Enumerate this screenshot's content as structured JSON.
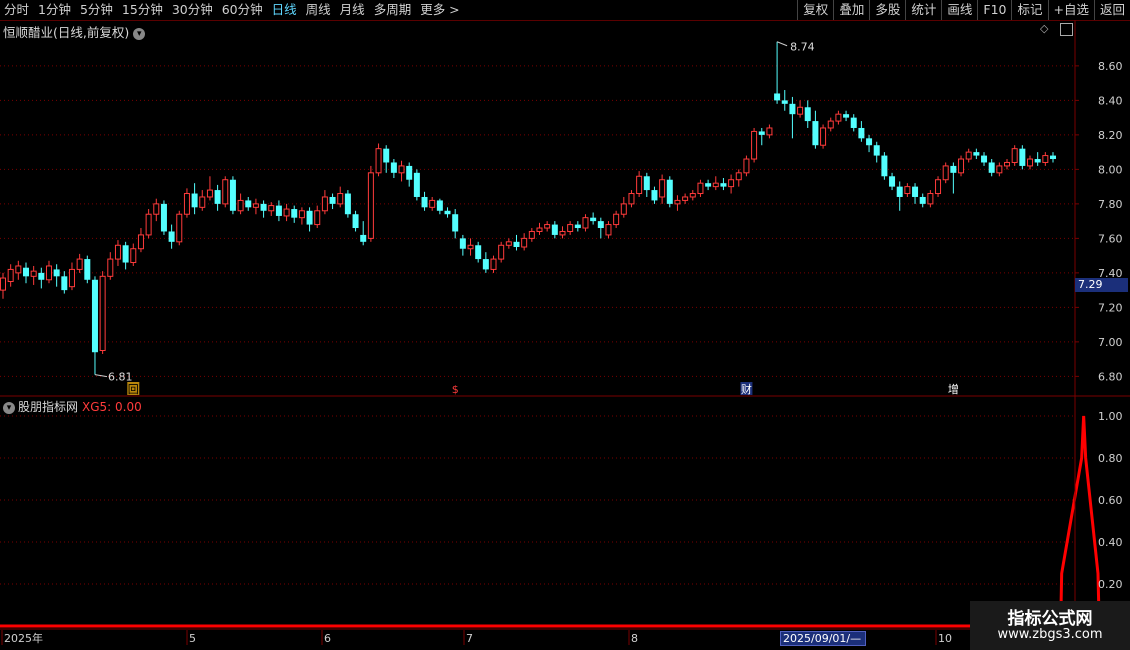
{
  "toolbar": {
    "periods": [
      "分时",
      "1分钟",
      "5分钟",
      "15分钟",
      "30分钟",
      "60分钟",
      "日线",
      "周线",
      "月线",
      "多周期",
      "更多 >"
    ],
    "active_index": 6,
    "actions": [
      "复权",
      "叠加",
      "多股",
      "统计",
      "画线",
      "F10",
      "标记",
      "+自选",
      "返回"
    ]
  },
  "main": {
    "title": "恒顺醋业(日线,前复权)",
    "price_labels": [
      "8.60",
      "8.40",
      "8.20",
      "8.00",
      "7.80",
      "7.60",
      "7.40",
      "7.29",
      "7.20",
      "7.00",
      "6.80"
    ],
    "current_price": "7.29",
    "high_label": "8.74",
    "low_label": "6.81",
    "markers": [
      "回",
      "$",
      "财",
      "增"
    ]
  },
  "indicator": {
    "name": "股朋指标网",
    "value": "XG5: 0.00",
    "labels": [
      "1.00",
      "0.80",
      "0.60",
      "0.40",
      "0.20"
    ]
  },
  "xaxis": {
    "labels": [
      "2025年",
      "5",
      "6",
      "7",
      "8",
      "10"
    ],
    "cursor_date": "2025/09/01/—"
  },
  "watermark": {
    "line1": "指标公式网",
    "line2": "www.zbgs3.com"
  },
  "colors": {
    "up": "#ff3b3b",
    "down": "#54ffff",
    "bg": "#000000",
    "grid": "#7a0000",
    "signal": "#ff0000"
  },
  "chart_data": {
    "type": "candlestick",
    "ylim": [
      6.75,
      8.75
    ],
    "indicator_ylim": [
      0,
      1.0
    ],
    "candles": [
      [
        7.3,
        7.37,
        7.25,
        7.4
      ],
      [
        7.35,
        7.42,
        7.32,
        7.45
      ],
      [
        7.4,
        7.44,
        7.36,
        7.47
      ],
      [
        7.43,
        7.38,
        7.34,
        7.46
      ],
      [
        7.38,
        7.41,
        7.33,
        7.44
      ],
      [
        7.4,
        7.36,
        7.31,
        7.43
      ],
      [
        7.36,
        7.44,
        7.34,
        7.47
      ],
      [
        7.42,
        7.38,
        7.32,
        7.45
      ],
      [
        7.38,
        7.3,
        7.28,
        7.41
      ],
      [
        7.32,
        7.42,
        7.3,
        7.46
      ],
      [
        7.42,
        7.48,
        7.4,
        7.51
      ],
      [
        7.48,
        7.36,
        7.34,
        7.5
      ],
      [
        7.36,
        6.94,
        6.81,
        7.38
      ],
      [
        6.95,
        7.38,
        6.93,
        7.41
      ],
      [
        7.38,
        7.48,
        7.36,
        7.52
      ],
      [
        7.48,
        7.56,
        7.44,
        7.59
      ],
      [
        7.56,
        7.46,
        7.42,
        7.58
      ],
      [
        7.46,
        7.54,
        7.44,
        7.57
      ],
      [
        7.54,
        7.62,
        7.52,
        7.66
      ],
      [
        7.62,
        7.74,
        7.6,
        7.77
      ],
      [
        7.74,
        7.8,
        7.7,
        7.83
      ],
      [
        7.8,
        7.64,
        7.62,
        7.82
      ],
      [
        7.64,
        7.58,
        7.54,
        7.68
      ],
      [
        7.58,
        7.74,
        7.56,
        7.76
      ],
      [
        7.74,
        7.86,
        7.72,
        7.89
      ],
      [
        7.86,
        7.78,
        7.74,
        7.92
      ],
      [
        7.78,
        7.84,
        7.76,
        7.88
      ],
      [
        7.84,
        7.88,
        7.82,
        7.96
      ],
      [
        7.88,
        7.8,
        7.76,
        7.91
      ],
      [
        7.8,
        7.94,
        7.78,
        7.96
      ],
      [
        7.94,
        7.76,
        7.74,
        7.96
      ],
      [
        7.76,
        7.82,
        7.74,
        7.86
      ],
      [
        7.82,
        7.78,
        7.76,
        7.84
      ],
      [
        7.78,
        7.8,
        7.74,
        7.83
      ],
      [
        7.8,
        7.76,
        7.72,
        7.82
      ],
      [
        7.76,
        7.79,
        7.73,
        7.81
      ],
      [
        7.79,
        7.73,
        7.7,
        7.82
      ],
      [
        7.73,
        7.77,
        7.7,
        7.8
      ],
      [
        7.77,
        7.72,
        7.69,
        7.79
      ],
      [
        7.72,
        7.76,
        7.68,
        7.78
      ],
      [
        7.76,
        7.68,
        7.64,
        7.78
      ],
      [
        7.68,
        7.76,
        7.66,
        7.79
      ],
      [
        7.76,
        7.84,
        7.74,
        7.88
      ],
      [
        7.84,
        7.8,
        7.77,
        7.86
      ],
      [
        7.8,
        7.86,
        7.78,
        7.9
      ],
      [
        7.86,
        7.74,
        7.72,
        7.88
      ],
      [
        7.74,
        7.66,
        7.64,
        7.76
      ],
      [
        7.62,
        7.58,
        7.56,
        7.7
      ],
      [
        7.6,
        7.98,
        7.58,
        8.02
      ],
      [
        7.98,
        8.12,
        7.96,
        8.15
      ],
      [
        8.12,
        8.04,
        7.98,
        8.14
      ],
      [
        8.04,
        7.98,
        7.95,
        8.06
      ],
      [
        7.98,
        8.02,
        7.93,
        8.05
      ],
      [
        8.02,
        7.94,
        7.9,
        8.04
      ],
      [
        7.98,
        7.84,
        7.82,
        8.0
      ],
      [
        7.84,
        7.78,
        7.76,
        7.87
      ],
      [
        7.78,
        7.82,
        7.76,
        7.84
      ],
      [
        7.82,
        7.76,
        7.74,
        7.83
      ],
      [
        7.76,
        7.74,
        7.72,
        7.78
      ],
      [
        7.74,
        7.64,
        7.6,
        7.77
      ],
      [
        7.6,
        7.54,
        7.5,
        7.62
      ],
      [
        7.54,
        7.56,
        7.5,
        7.6
      ],
      [
        7.56,
        7.48,
        7.46,
        7.58
      ],
      [
        7.48,
        7.42,
        7.4,
        7.52
      ],
      [
        7.42,
        7.48,
        7.4,
        7.5
      ],
      [
        7.48,
        7.56,
        7.46,
        7.58
      ],
      [
        7.56,
        7.58,
        7.54,
        7.6
      ],
      [
        7.58,
        7.55,
        7.53,
        7.62
      ],
      [
        7.55,
        7.6,
        7.53,
        7.63
      ],
      [
        7.6,
        7.64,
        7.58,
        7.66
      ],
      [
        7.64,
        7.66,
        7.62,
        7.69
      ],
      [
        7.66,
        7.68,
        7.64,
        7.7
      ],
      [
        7.68,
        7.62,
        7.6,
        7.7
      ],
      [
        7.62,
        7.64,
        7.6,
        7.67
      ],
      [
        7.64,
        7.68,
        7.62,
        7.7
      ],
      [
        7.68,
        7.66,
        7.64,
        7.7
      ],
      [
        7.66,
        7.72,
        7.64,
        7.74
      ],
      [
        7.72,
        7.7,
        7.68,
        7.75
      ],
      [
        7.7,
        7.66,
        7.6,
        7.72
      ],
      [
        7.62,
        7.68,
        7.6,
        7.7
      ],
      [
        7.68,
        7.74,
        7.66,
        7.76
      ],
      [
        7.74,
        7.8,
        7.72,
        7.84
      ],
      [
        7.8,
        7.86,
        7.78,
        7.88
      ],
      [
        7.86,
        7.96,
        7.84,
        7.99
      ],
      [
        7.96,
        7.88,
        7.84,
        7.98
      ],
      [
        7.88,
        7.82,
        7.8,
        7.9
      ],
      [
        7.84,
        7.94,
        7.8,
        7.97
      ],
      [
        7.94,
        7.8,
        7.78,
        7.96
      ],
      [
        7.8,
        7.82,
        7.76,
        7.85
      ],
      [
        7.82,
        7.84,
        7.8,
        7.86
      ],
      [
        7.84,
        7.86,
        7.82,
        7.88
      ],
      [
        7.86,
        7.92,
        7.84,
        7.94
      ],
      [
        7.92,
        7.9,
        7.88,
        7.94
      ],
      [
        7.9,
        7.92,
        7.88,
        7.96
      ],
      [
        7.92,
        7.9,
        7.88,
        7.95
      ],
      [
        7.9,
        7.94,
        7.86,
        7.97
      ],
      [
        7.94,
        7.98,
        7.9,
        8.0
      ],
      [
        7.98,
        8.06,
        7.96,
        8.08
      ],
      [
        8.06,
        8.22,
        8.04,
        8.24
      ],
      [
        8.22,
        8.2,
        8.14,
        8.24
      ],
      [
        8.2,
        8.24,
        8.18,
        8.26
      ],
      [
        8.44,
        8.4,
        8.38,
        8.74
      ],
      [
        8.4,
        8.38,
        8.34,
        8.46
      ],
      [
        8.38,
        8.32,
        8.18,
        8.42
      ],
      [
        8.32,
        8.36,
        8.3,
        8.4
      ],
      [
        8.36,
        8.28,
        8.24,
        8.4
      ],
      [
        8.28,
        8.14,
        8.12,
        8.34
      ],
      [
        8.14,
        8.24,
        8.12,
        8.26
      ],
      [
        8.24,
        8.28,
        8.22,
        8.3
      ],
      [
        8.28,
        8.32,
        8.26,
        8.34
      ],
      [
        8.32,
        8.3,
        8.28,
        8.34
      ],
      [
        8.3,
        8.24,
        8.22,
        8.32
      ],
      [
        8.24,
        8.18,
        8.16,
        8.28
      ],
      [
        8.18,
        8.14,
        8.1,
        8.2
      ],
      [
        8.14,
        8.08,
        8.04,
        8.16
      ],
      [
        8.08,
        7.96,
        7.94,
        8.1
      ],
      [
        7.96,
        7.9,
        7.88,
        7.98
      ],
      [
        7.9,
        7.84,
        7.76,
        7.93
      ],
      [
        7.86,
        7.9,
        7.84,
        7.92
      ],
      [
        7.9,
        7.84,
        7.8,
        7.92
      ],
      [
        7.84,
        7.8,
        7.78,
        7.86
      ],
      [
        7.8,
        7.86,
        7.78,
        7.88
      ],
      [
        7.86,
        7.94,
        7.84,
        7.96
      ],
      [
        7.94,
        8.02,
        7.92,
        8.04
      ],
      [
        8.02,
        7.98,
        7.86,
        8.04
      ],
      [
        7.98,
        8.06,
        7.96,
        8.08
      ],
      [
        8.06,
        8.1,
        8.04,
        8.12
      ],
      [
        8.1,
        8.08,
        8.06,
        8.12
      ],
      [
        8.08,
        8.04,
        8.02,
        8.1
      ],
      [
        8.04,
        7.98,
        7.96,
        8.06
      ],
      [
        7.98,
        8.02,
        7.96,
        8.04
      ],
      [
        8.02,
        8.04,
        8.0,
        8.06
      ],
      [
        8.04,
        8.12,
        8.02,
        8.14
      ],
      [
        8.12,
        8.02,
        8.0,
        8.14
      ],
      [
        8.02,
        8.06,
        8.0,
        8.08
      ],
      [
        8.06,
        8.04,
        8.02,
        8.1
      ],
      [
        8.04,
        8.08,
        8.02,
        8.1
      ],
      [
        8.08,
        8.06,
        8.04,
        8.1
      ]
    ],
    "indicator_signal": {
      "rise_start_index": 138,
      "peak_index": 141,
      "peak_value": 1.0,
      "baseline": 0.0
    }
  }
}
